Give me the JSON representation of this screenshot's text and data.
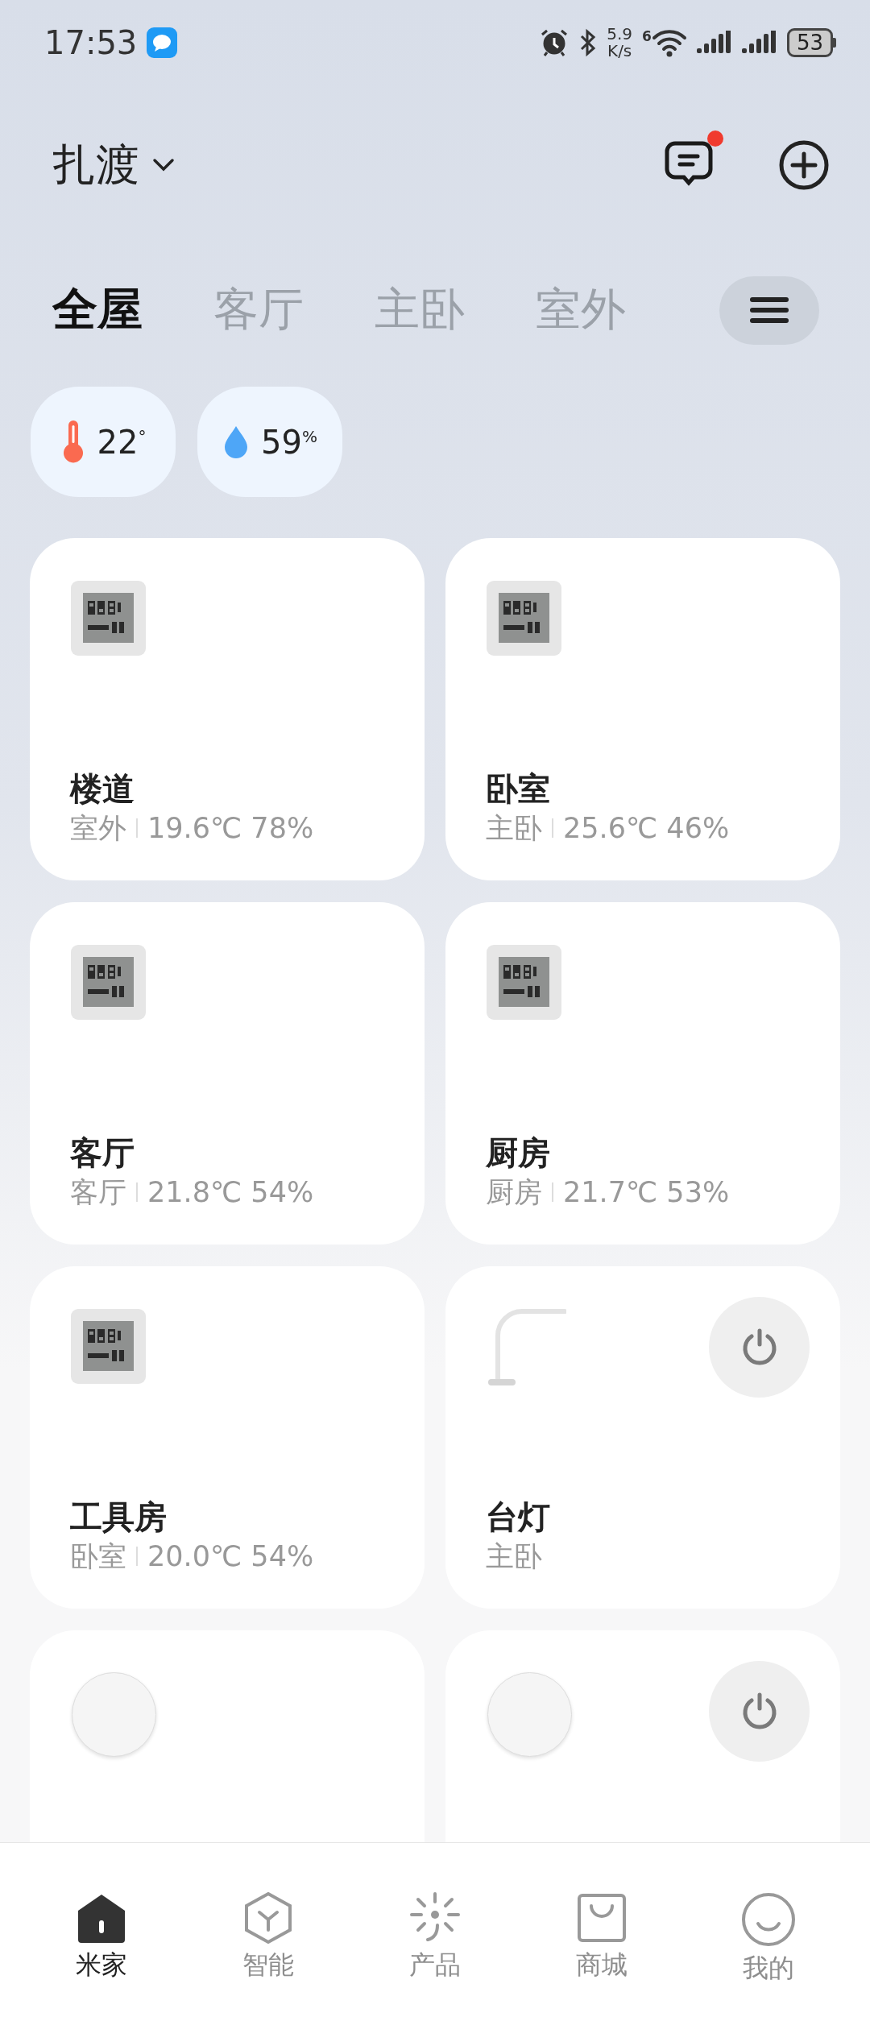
{
  "status_bar": {
    "time": "17:53",
    "network_speed": "5.9",
    "network_speed_unit": "K/s",
    "wifi_label": "6",
    "battery": "53"
  },
  "header": {
    "home_name": "扎渡",
    "messages": {
      "unread": true
    }
  },
  "room_tabs": [
    {
      "label": "全屋",
      "selected": true
    },
    {
      "label": "客厅",
      "selected": false
    },
    {
      "label": "主卧",
      "selected": false
    },
    {
      "label": "室外",
      "selected": false
    }
  ],
  "climate": [
    {
      "kind": "temperature",
      "value": "22$^{°}$"
    },
    {
      "kind": "humidity",
      "value": "59$^{%}$"
    }
  ],
  "devices": [
    {
      "kind": "hygrometer",
      "name": "楼道",
      "room": "室外",
      "reading": "19.6℃ 78%",
      "power_button": false
    },
    {
      "kind": "hygrometer",
      "name": "卧室",
      "room": "主卧",
      "reading": "25.6℃ 46%",
      "power_button": false
    },
    {
      "kind": "hygrometer",
      "name": "客厅",
      "room": "客厅",
      "reading": "21.8℃ 54%",
      "power_button": false
    },
    {
      "kind": "hygrometer",
      "name": "厨房",
      "room": "厨房",
      "reading": "21.7℃ 53%",
      "power_button": false
    },
    {
      "kind": "hygrometer",
      "name": "工具房",
      "room": "卧室",
      "reading": "20.0℃ 54%",
      "power_button": false
    },
    {
      "kind": "lamp",
      "name": "台灯",
      "room": "主卧",
      "power_button": true
    },
    {
      "kind": "circle",
      "power_button": false
    },
    {
      "kind": "circle",
      "power_button": true
    }
  ],
  "bottom_nav": [
    {
      "kind": "home",
      "label": "米家",
      "selected": true
    },
    {
      "kind": "smart",
      "label": "智能",
      "selected": false
    },
    {
      "kind": "product",
      "label": "产品",
      "selected": false
    },
    {
      "kind": "store",
      "label": "商城",
      "selected": false
    },
    {
      "kind": "profile",
      "label": "我的",
      "selected": false
    }
  ]
}
